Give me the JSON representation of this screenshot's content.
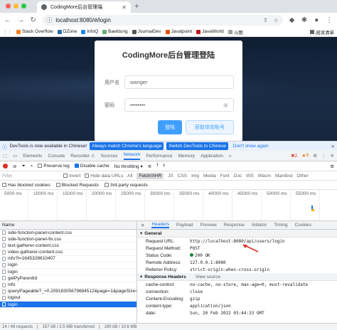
{
  "browser": {
    "tab_title": "CodingMore后台管理端",
    "url": "localhost:8080/#/login",
    "bookmarks": [
      "Stack Overflow",
      "DZone",
      "InfoQ",
      "Baeldung",
      "JournalDev",
      "Javatpoint",
      "JavaWorld",
      "斗图"
    ],
    "bookmarks_right": "阅读清单"
  },
  "login": {
    "title": "CodingMore后台管理登陆",
    "username_label": "用户名",
    "username_value": "wanger",
    "password_label": "密码",
    "password_value": "••••••••",
    "login_button": "登陆",
    "trial_button": "获取体验账号"
  },
  "banner": {
    "message": "DevTools is now available in Chinese!",
    "btn_match": "Always match Chrome's language",
    "btn_switch": "Switch DevTools to Chinese",
    "btn_dont": "Don't show again"
  },
  "devtools": {
    "tabs": [
      "Elements",
      "Console",
      "Recorder ⚠",
      "Sources",
      "Network",
      "Performance",
      "Memory",
      "Application"
    ],
    "error_count": "2",
    "warning_count": "6",
    "toolbar": {
      "preserve_log": "Preserve log",
      "disable_cache": "Disable cache",
      "throttle": "No throttling"
    },
    "filter": {
      "placeholder": "Filter",
      "invert": "Invert",
      "hide_data": "Hide data URLs",
      "types": [
        "All",
        "Fetch/XHR",
        "JS",
        "CSS",
        "Img",
        "Media",
        "Font",
        "Doc",
        "WS",
        "Wasm",
        "Manifest",
        "Other"
      ]
    },
    "blocked": {
      "has_cookies": "Has blocked cookies",
      "blocked_requests": "Blocked Requests",
      "third_party": "3rd-party requests"
    },
    "timeline_ticks": [
      "5000 ms",
      "10000 ms",
      "15000 ms",
      "20000 ms",
      "25000 ms",
      "30000 ms",
      "35000 ms",
      "40000 ms",
      "45000 ms",
      "50000 ms",
      "55000 ms"
    ]
  },
  "requests": {
    "header": "Name",
    "items": [
      "side-function-panel-content.css",
      "side-function-panel-fix.css",
      "text-gatherer-content.css",
      "video-gatherer-content.css",
      "info?t=1645328610407",
      "login",
      "login",
      "getPyParentId",
      "info",
      "queryPageable?_=0.20918305679684512&page=1&pageSize=...",
      "logout",
      "login"
    ],
    "selected_index": 11
  },
  "detail": {
    "tabs": [
      "Headers",
      "Payload",
      "Preview",
      "Response",
      "Initiator",
      "Timing",
      "Cookies"
    ],
    "general_title": "General",
    "general": [
      {
        "k": "Request URL:",
        "v": "http://localhost:8080/api/users/login"
      },
      {
        "k": "Request Method:",
        "v": "POST"
      },
      {
        "k": "Status Code:",
        "v": "200 OK"
      },
      {
        "k": "Remote Address:",
        "v": "127.0.0.1:8080"
      },
      {
        "k": "Referrer Policy:",
        "v": "strict-origin-when-cross-origin"
      }
    ],
    "response_title": "Response Headers",
    "view_source": "View source",
    "response": [
      {
        "k": "cache-control:",
        "v": "no-cache, no-store, max-age=0, must-revalidate"
      },
      {
        "k": "connection:",
        "v": "close"
      },
      {
        "k": "Content-Encoding:",
        "v": "gzip"
      },
      {
        "k": "content-type:",
        "v": "application/json"
      },
      {
        "k": "date:",
        "v": "Sun, 20 Feb 2022 03:44:33 GMT"
      }
    ]
  },
  "statusbar": {
    "requests": "14 / 49 requests",
    "transferred": "157 kB / 2.5 MB transferred",
    "resources": "190 kB / 10.6 MB"
  }
}
